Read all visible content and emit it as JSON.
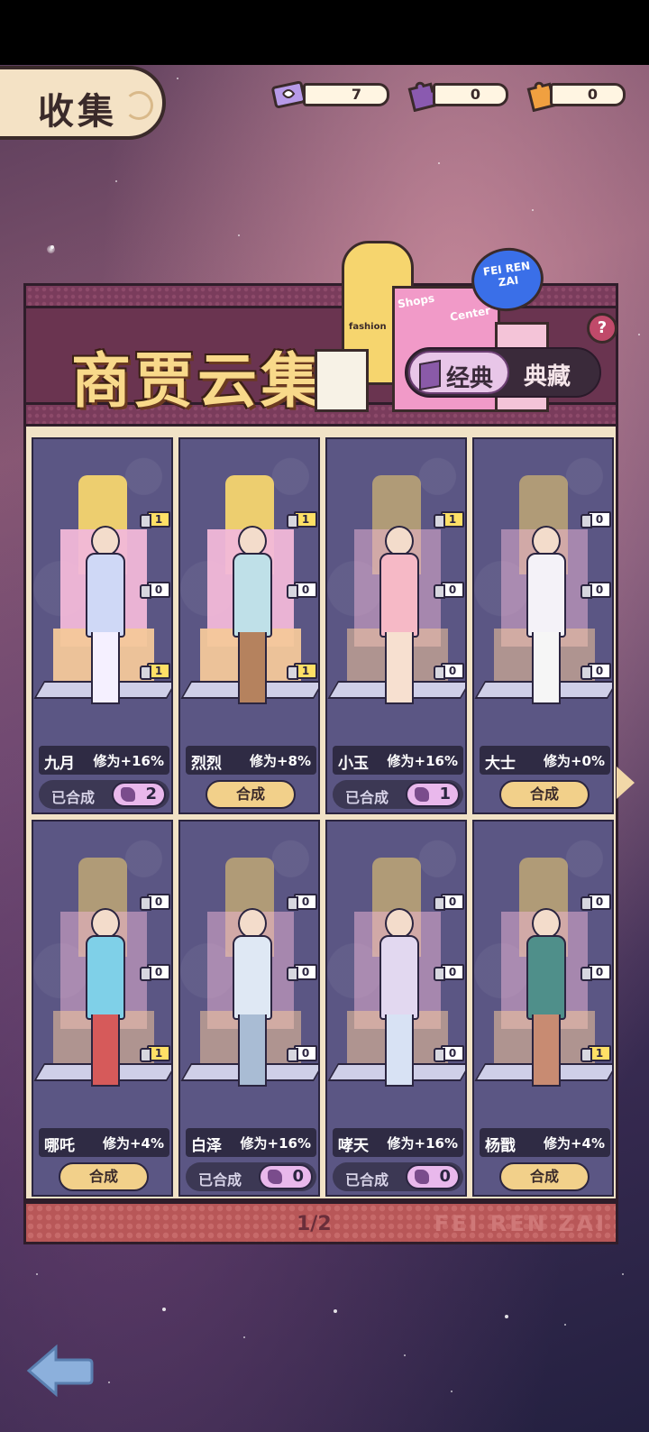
{
  "header": {
    "title": "收集"
  },
  "resources": [
    {
      "icon": "ticket-icon",
      "value": "7"
    },
    {
      "icon": "purple-puzzle-icon",
      "value": "0"
    },
    {
      "icon": "orange-puzzle-icon",
      "value": "0"
    }
  ],
  "panel": {
    "title": "商贾云集",
    "signage_text": [
      "fashion",
      "Shops",
      "Center",
      "FEI REN ZAI"
    ],
    "toggle": {
      "active": "经典",
      "inactive": "典藏"
    },
    "help": "?"
  },
  "cards": [
    {
      "name": "九月",
      "bonus": "修为+16%",
      "badges": [
        "1",
        "0",
        "1"
      ],
      "state": "done",
      "done_label": "已合成",
      "count": "2",
      "body_color": "#cfd8f6",
      "legs_color": "#f5f0ff",
      "lit": true
    },
    {
      "name": "烈烈",
      "bonus": "修为+8%",
      "badges": [
        "1",
        "0",
        "1"
      ],
      "state": "compose",
      "compose_label": "合成",
      "body_color": "#bfe0e8",
      "legs_color": "#b5825e",
      "lit": true
    },
    {
      "name": "小玉",
      "bonus": "修为+16%",
      "badges": [
        "1",
        "0",
        "0"
      ],
      "state": "done",
      "done_label": "已合成",
      "count": "1",
      "body_color": "#f6b9c6",
      "legs_color": "#f7e0d0",
      "lit": false
    },
    {
      "name": "大士",
      "bonus": "修为+0%",
      "badges": [
        "0",
        "0",
        "0"
      ],
      "state": "compose",
      "compose_label": "合成",
      "body_color": "#f4f2f8",
      "legs_color": "#f6f6f6",
      "lit": false
    },
    {
      "name": "哪吒",
      "bonus": "修为+4%",
      "badges": [
        "0",
        "0",
        "1"
      ],
      "state": "compose",
      "compose_label": "合成",
      "body_color": "#7fd0e8",
      "legs_color": "#d65a5a",
      "lit": false
    },
    {
      "name": "白泽",
      "bonus": "修为+16%",
      "badges": [
        "0",
        "0",
        "0"
      ],
      "state": "done",
      "done_label": "已合成",
      "count": "0",
      "body_color": "#dfe8f4",
      "legs_color": "#a9bcd4",
      "lit": false
    },
    {
      "name": "哮天",
      "bonus": "修为+16%",
      "badges": [
        "0",
        "0",
        "0"
      ],
      "state": "done",
      "done_label": "已合成",
      "count": "0",
      "body_color": "#e2d8f0",
      "legs_color": "#d8e2f4",
      "lit": false
    },
    {
      "name": "杨戬",
      "bonus": "修为+4%",
      "badges": [
        "0",
        "0",
        "1"
      ],
      "state": "compose",
      "compose_label": "合成",
      "body_color": "#4f8f8a",
      "legs_color": "#c88b72",
      "lit": false
    }
  ],
  "footer": {
    "page": "1/2",
    "brand": "FEI REN ZAI"
  },
  "nav": {
    "back_icon": "back-arrow-icon",
    "next_icon": "next-page-arrow-icon"
  }
}
